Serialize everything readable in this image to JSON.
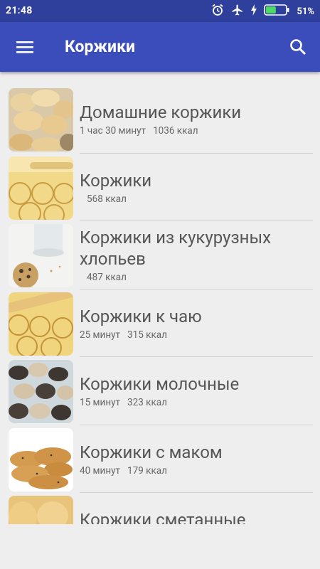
{
  "status_bar": {
    "time": "21:48",
    "battery": "51%",
    "battery_fraction": 0.51
  },
  "app_bar": {
    "title": "Коржики"
  },
  "recipes": [
    {
      "title": "Домашние коржики",
      "time": "1 час 30 минут",
      "kcal": "1036 ккал",
      "image": "homemade-cookies"
    },
    {
      "title": "Коржики",
      "time": "",
      "kcal": "568 ккал",
      "image": "cut-dough-circles"
    },
    {
      "title": "Коржики из кукурузных хлопьев",
      "time": "",
      "kcal": "487 ккал",
      "image": "cornflake-cookie-with-milk"
    },
    {
      "title": "Коржики к чаю",
      "time": "25 минут",
      "kcal": "315 ккал",
      "image": "cut-dough-circles-rolling-pin"
    },
    {
      "title": "Коржики молочные",
      "time": "15 минут",
      "kcal": "323 ккал",
      "image": "poppy-seed-cookies-tray"
    },
    {
      "title": "Коржики с маком",
      "time": "40 минут",
      "kcal": "179 ккал",
      "image": "stacked-poppy-cookies"
    },
    {
      "title": "Коржики сметанные",
      "time": "",
      "kcal": "",
      "image": "golden-cookies"
    }
  ]
}
